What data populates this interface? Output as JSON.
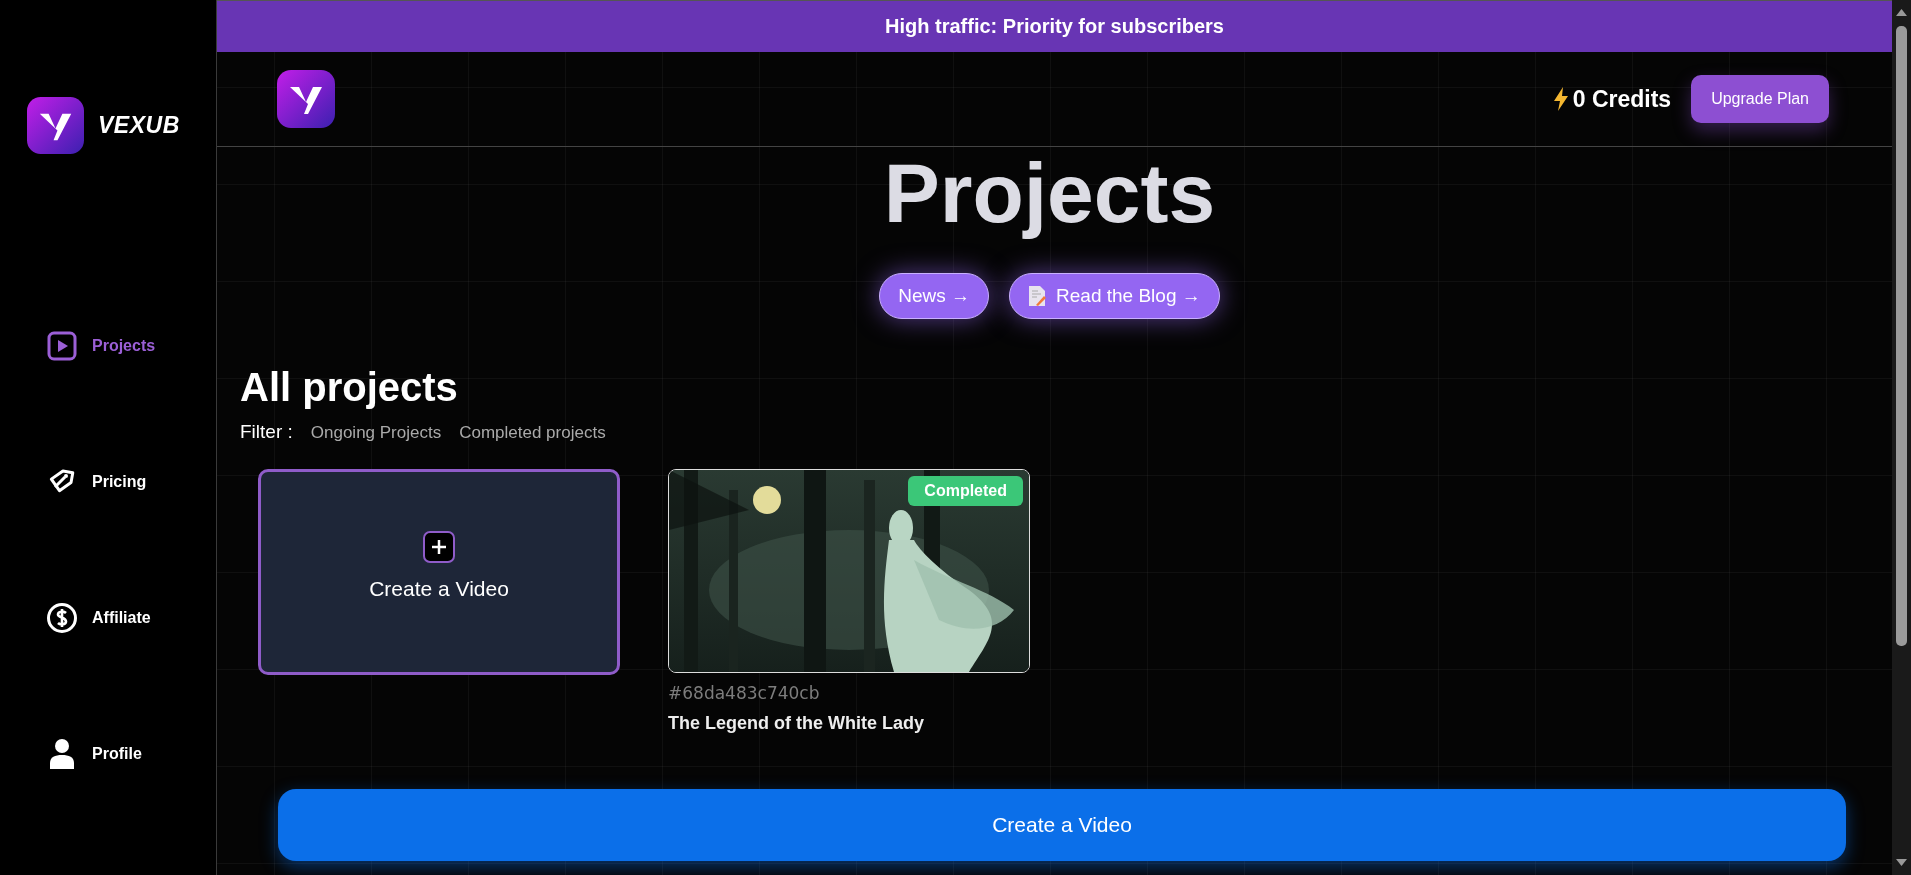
{
  "banner": {
    "text": "High traffic: Priority for subscribers"
  },
  "sidebar": {
    "brand": "VEXUB",
    "items": [
      {
        "label": "Projects",
        "kind": "play",
        "selected": true
      },
      {
        "label": "Pricing",
        "kind": "tag",
        "selected": false
      },
      {
        "label": "Affiliate",
        "kind": "dollar",
        "selected": false
      },
      {
        "label": "Profile",
        "kind": "person",
        "selected": false
      }
    ]
  },
  "header": {
    "credits": "0 Credits",
    "upgrade_button": "Upgrade Plan"
  },
  "page_title": "Projects",
  "links": [
    {
      "label": "News →",
      "kind": "plain"
    },
    {
      "label": "Read the Blog →",
      "kind": "blog"
    }
  ],
  "projects": {
    "heading": "All projects",
    "filter_label": "Filter :",
    "filters": [
      {
        "label": "Ongoing Projects",
        "selected": false
      },
      {
        "label": "Completed projects",
        "selected": false
      }
    ],
    "create_card": {
      "label": "Create a Video"
    },
    "items": [
      {
        "id": "#68da483c740cb",
        "title": "The Legend of the White Lady",
        "status": "Completed",
        "kind": "picture"
      }
    ]
  },
  "cta_button": "Create a Video"
}
